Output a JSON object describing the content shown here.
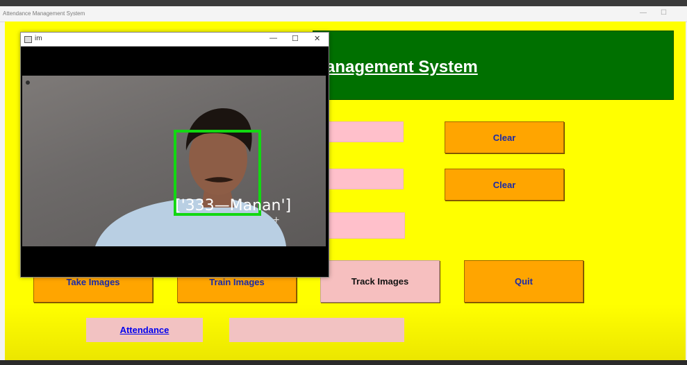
{
  "main_window": {
    "title": "Attendance Management System",
    "minimize_symbol": "—",
    "maximize_symbol": "☐"
  },
  "header": {
    "title": "anagement System"
  },
  "buttons": {
    "clear_1": "Clear",
    "clear_2": "Clear",
    "take_images": "Take Images",
    "train_images": "Train Images",
    "track_images": "Track Images",
    "quit": "Quit",
    "attendance": "Attendance"
  },
  "camera_window": {
    "title": "im",
    "minimize_symbol": "—",
    "maximize_symbol": "☐",
    "close_symbol": "✕",
    "face_label": "['333—Manan']",
    "crosshair_symbol": "+"
  },
  "colors": {
    "background": "#ffff00",
    "header": "#007000",
    "button": "#ffa500",
    "field": "#ffc0cb",
    "face_box": "#12d812"
  }
}
